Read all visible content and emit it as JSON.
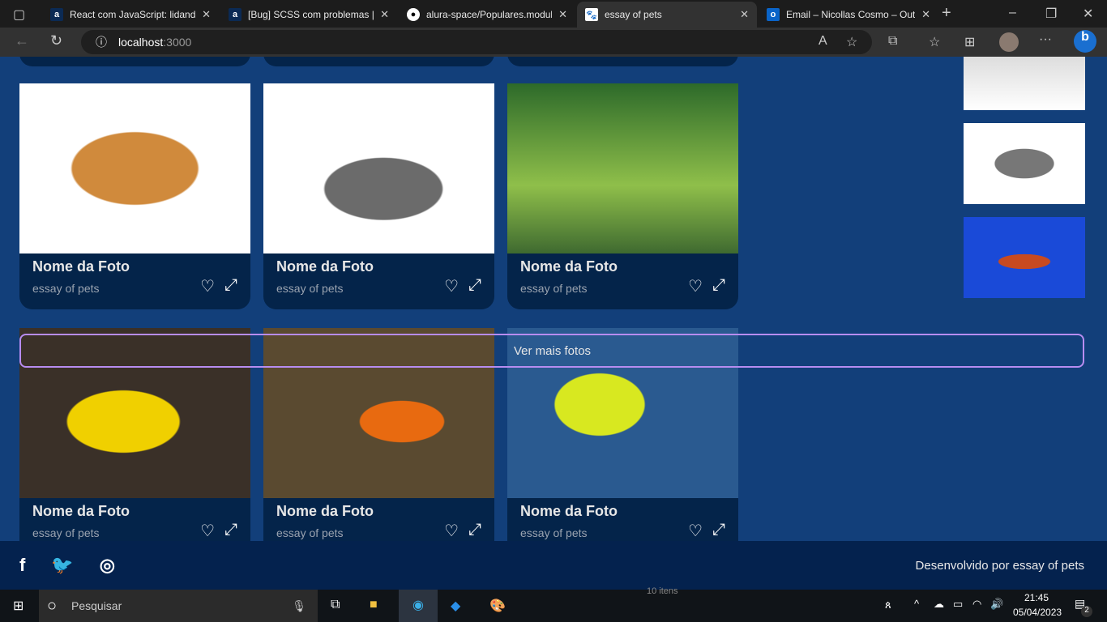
{
  "browser": {
    "tabs": [
      {
        "title": "React com JavaScript: lidando",
        "icon": "alura-icon"
      },
      {
        "title": "[Bug] SCSS com problemas | F",
        "icon": "alura-icon"
      },
      {
        "title": "alura-space/Populares.modul",
        "icon": "github-icon"
      },
      {
        "title": "essay of pets",
        "icon": "paw-icon",
        "active": true
      },
      {
        "title": "Email – Nicollas Cosmo – Out",
        "icon": "outlook-icon"
      }
    ],
    "url_host": "localhost",
    "url_port": ":3000"
  },
  "gallery": {
    "cards": [
      {
        "name": "Nome da Foto",
        "subtitle": "essay of pets",
        "image": "orange cat"
      },
      {
        "name": "Nome da Foto",
        "subtitle": "essay of pets",
        "image": "tabby cat"
      },
      {
        "name": "Nome da Foto",
        "subtitle": "essay of pets",
        "image": "parrots"
      },
      {
        "name": "Nome da Foto",
        "subtitle": "essay of pets",
        "image": "yellow parrots"
      },
      {
        "name": "Nome da Foto",
        "subtitle": "essay of pets",
        "image": "clownfish"
      },
      {
        "name": "Nome da Foto",
        "subtitle": "essay of pets",
        "image": "yellow fish"
      }
    ],
    "more_label": "Ver mais fotos"
  },
  "footer": {
    "credit": "Desenvolvido por essay of pets",
    "social": [
      "facebook-icon",
      "twitter-icon",
      "instagram-icon"
    ]
  },
  "taskbar": {
    "search_placeholder": "Pesquisar",
    "time": "21:45",
    "date": "05/04/2023",
    "notifications": "2",
    "explorer_status": "10 itens"
  }
}
